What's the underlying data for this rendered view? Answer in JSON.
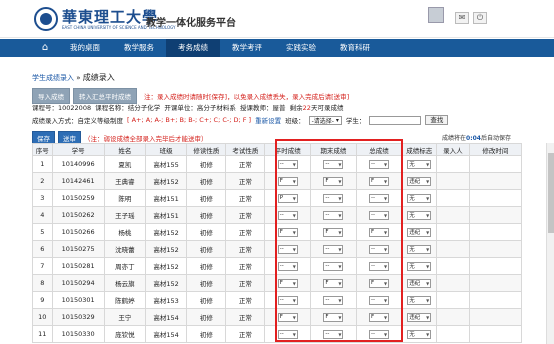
{
  "header": {
    "logo_text": "華東理工大學",
    "logo_sub": "EAST CHINA UNIVERSITY OF SCIENCE AND TECHNOLOGY",
    "platform": "教学一体化服务平台"
  },
  "nav": {
    "items": [
      {
        "label": "我的桌面"
      },
      {
        "label": "教学服务"
      },
      {
        "label": "考务成绩"
      },
      {
        "label": "教学考评"
      },
      {
        "label": "实践实验"
      },
      {
        "label": "教育科研"
      }
    ]
  },
  "breadcrumb": {
    "parent": "学生成绩录入",
    "sep": "»",
    "current": "成绩录入"
  },
  "buttons": {
    "import": "导入成绩",
    "import_regular": "转入汇总平时成绩",
    "warning": "注：录入成绩时请随时[保存]，以免录入成绩丢失，录入完成后请[送审]"
  },
  "info": {
    "course_no_label": "课程号：",
    "course_no": "10022008",
    "course_name_label": "课程名称：",
    "course_name": "结分子化学",
    "dept_label": "开课单位：",
    "dept": "高分子材料系",
    "teacher_label": "授课教师：",
    "teacher": "屋普",
    "remaining_label": "剩余",
    "remaining": "22",
    "remaining_suffix": "天可录成绩"
  },
  "method": {
    "label": "成绩录入方式：自定义等级制度",
    "grades": "[ A+; A; A-; B+; B; B-; C+; C; C-; D; F ]",
    "reset": "重新设置",
    "class_label": "班级：",
    "class_select": "-请选择-",
    "student_label": "学生：",
    "search": "查找"
  },
  "savebar": {
    "save": "保存",
    "submit": "送审",
    "note": "（注：弱设成绩全部录入完毕后才能送审）",
    "autosave_prefix": "成绩将在",
    "autosave_time": "0:04",
    "autosave_suffix": "后自动保存"
  },
  "table": {
    "headers": [
      "序号",
      "学号",
      "姓名",
      "班级",
      "修读性质",
      "考试性质",
      "平时成绩",
      "期末成绩",
      "总成绩",
      "成绩标志",
      "录入人",
      "修改时间"
    ],
    "rows": [
      {
        "no": "1",
        "id": "10140996",
        "name": "夏凯",
        "class": "高材155",
        "type": "初修",
        "exam": "正常",
        "regular": "--",
        "final": "--",
        "total": "--",
        "flag": "无"
      },
      {
        "no": "2",
        "id": "10142461",
        "name": "王典睿",
        "class": "高材152",
        "type": "初修",
        "exam": "正常",
        "regular": "F",
        "final": "F",
        "total": "F",
        "flag": "违纪"
      },
      {
        "no": "3",
        "id": "10150259",
        "name": "陈明",
        "class": "高材151",
        "type": "初修",
        "exam": "正常",
        "regular": "P",
        "final": "--",
        "total": "--",
        "flag": "无"
      },
      {
        "no": "4",
        "id": "10150262",
        "name": "王子瑶",
        "class": "高材151",
        "type": "初修",
        "exam": "正常",
        "regular": "--",
        "final": "--",
        "total": "--",
        "flag": "无"
      },
      {
        "no": "5",
        "id": "10150266",
        "name": "杨桃",
        "class": "高材152",
        "type": "初修",
        "exam": "正常",
        "regular": "F",
        "final": "F",
        "total": "F",
        "flag": "违纪"
      },
      {
        "no": "6",
        "id": "10150275",
        "name": "沈晓蕾",
        "class": "高材152",
        "type": "初修",
        "exam": "正常",
        "regular": "--",
        "final": "--",
        "total": "--",
        "flag": "无"
      },
      {
        "no": "7",
        "id": "10150281",
        "name": "周亦丁",
        "class": "高材152",
        "type": "初修",
        "exam": "正常",
        "regular": "--",
        "final": "--",
        "total": "--",
        "flag": "无"
      },
      {
        "no": "8",
        "id": "10150294",
        "name": "杨云旗",
        "class": "高材152",
        "type": "初修",
        "exam": "正常",
        "regular": "F",
        "final": "F",
        "total": "F",
        "flag": "违纪"
      },
      {
        "no": "9",
        "id": "10150301",
        "name": "陈鹤婷",
        "class": "高材153",
        "type": "初修",
        "exam": "正常",
        "regular": "--",
        "final": "--",
        "total": "--",
        "flag": "无"
      },
      {
        "no": "10",
        "id": "10150329",
        "name": "王宁",
        "class": "高材154",
        "type": "初修",
        "exam": "正常",
        "regular": "F",
        "final": "F",
        "total": "F",
        "flag": "违纪"
      },
      {
        "no": "11",
        "id": "10150330",
        "name": "庞钦悦",
        "class": "高材154",
        "type": "初修",
        "exam": "正常",
        "regular": "--",
        "final": "--",
        "total": "--",
        "flag": "无"
      }
    ]
  }
}
